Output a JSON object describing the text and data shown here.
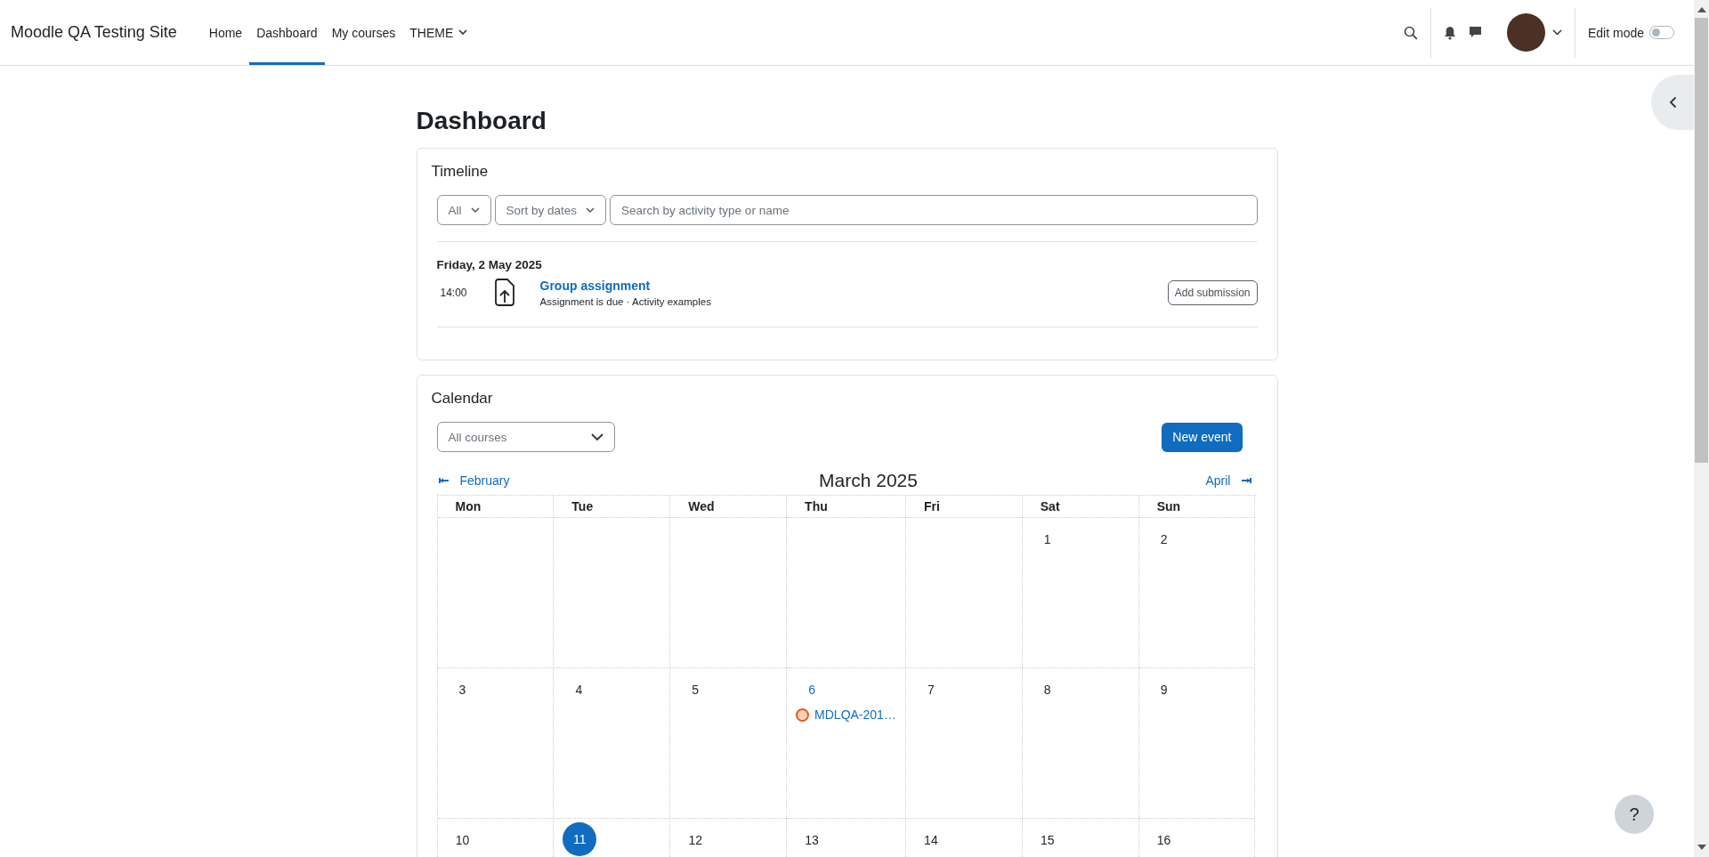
{
  "navbar": {
    "site_name": "Moodle QA Testing Site",
    "items": [
      {
        "label": "Home",
        "kind": "link",
        "selected": false
      },
      {
        "label": "Dashboard",
        "kind": "link",
        "selected": true
      },
      {
        "label": "My courses",
        "kind": "link",
        "selected": false
      },
      {
        "label": "THEME",
        "kind": "menu",
        "selected": false
      }
    ],
    "edit_mode": {
      "label": "Edit mode",
      "on": false
    }
  },
  "page_title": "Dashboard",
  "timeline": {
    "title": "Timeline",
    "filter": "All",
    "sort": "Sort by dates",
    "search": {
      "placeholder": "Search by activity type or name"
    },
    "groups": [
      {
        "date": "Friday, 2 May 2025",
        "events": [
          {
            "time": "14:00",
            "title": "Group assignment",
            "details": "Assignment is due · Activity examples",
            "action": "Add submission"
          }
        ]
      }
    ]
  },
  "calendar": {
    "title": "Calendar",
    "course_filter": "All courses",
    "new_event": "New event",
    "previous_month": "February",
    "month": "March 2025",
    "next_month": "April",
    "weekdays": [
      "Mon",
      "Tue",
      "Wed",
      "Thu",
      "Fri",
      "Sat",
      "Sun"
    ],
    "weeks": [
      [
        {
          "day": "1",
          "today": false
        },
        {
          "day": "2",
          "today": false
        }
      ],
      [
        {
          "day": "3",
          "today": false
        },
        {
          "day": "4",
          "today": false
        },
        {
          "day": "5",
          "today": false
        },
        {
          "day": "6",
          "today": false,
          "events": [
            {
              "title": "MDLQA-201…",
              "color": "#e8581e"
            }
          ]
        },
        {
          "day": "7",
          "today": false
        },
        {
          "day": "8",
          "today": false
        },
        {
          "day": "9",
          "today": false
        }
      ],
      [
        {
          "day": "10",
          "today": false
        },
        {
          "day": "11",
          "today": true
        },
        {
          "day": "12",
          "today": false
        },
        {
          "day": "13",
          "today": false
        },
        {
          "day": "14",
          "today": false
        },
        {
          "day": "15",
          "today": false
        },
        {
          "day": "16",
          "today": false
        }
      ]
    ]
  },
  "help_button": "?"
}
